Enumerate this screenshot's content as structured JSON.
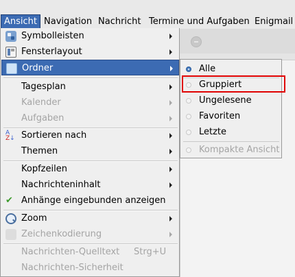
{
  "menubar": {
    "items": [
      {
        "label": "Ansicht",
        "active": true
      },
      {
        "label": "Navigation"
      },
      {
        "label": "Nachricht"
      },
      {
        "label": "Termine und Aufgaben"
      },
      {
        "label": "Enigmail"
      }
    ]
  },
  "menu": {
    "items": [
      {
        "label": "Symbolleisten",
        "icon": "toolbars-icon",
        "submenu": true,
        "enabled": true
      },
      {
        "label": "Fensterlayout",
        "icon": "layout-icon",
        "submenu": true,
        "enabled": true
      },
      {
        "label": "Ordner",
        "icon": "folder-icon",
        "submenu": true,
        "enabled": true,
        "highlighted": true
      },
      {
        "label": "Tagesplan",
        "submenu": true,
        "enabled": true
      },
      {
        "label": "Kalender",
        "submenu": true,
        "enabled": false
      },
      {
        "label": "Aufgaben",
        "submenu": true,
        "enabled": false
      },
      {
        "label": "Sortieren nach",
        "icon": "sort-az-icon",
        "submenu": true,
        "enabled": true
      },
      {
        "label": "Themen",
        "submenu": true,
        "enabled": true
      },
      {
        "label": "Kopfzeilen",
        "submenu": true,
        "enabled": true
      },
      {
        "label": "Nachrichteninhalt",
        "submenu": true,
        "enabled": true
      },
      {
        "label": "Anhänge eingebunden anzeigen",
        "icon": "check-icon",
        "checked": true,
        "enabled": true
      },
      {
        "label": "Zoom",
        "icon": "zoom-icon",
        "submenu": true,
        "enabled": true
      },
      {
        "label": "Zeichenkodierung",
        "icon": "charset-icon",
        "submenu": true,
        "enabled": false
      },
      {
        "label": "Nachrichten-Quelltext",
        "shortcut": "Strg+U",
        "enabled": false
      },
      {
        "label": "Nachrichten-Sicherheit",
        "enabled": false
      }
    ]
  },
  "submenu": {
    "items": [
      {
        "label": "Alle",
        "selected": true,
        "enabled": true
      },
      {
        "label": "Gruppiert",
        "selected": false,
        "enabled": true,
        "outlined": true
      },
      {
        "label": "Ungelesene",
        "selected": false,
        "enabled": true
      },
      {
        "label": "Favoriten",
        "selected": false,
        "enabled": true
      },
      {
        "label": "Letzte",
        "selected": false,
        "enabled": true
      },
      {
        "label": "Kompakte Ansicht",
        "selected": false,
        "enabled": false
      }
    ]
  },
  "colors": {
    "highlight": "#3c6bb3",
    "outline": "#e00000",
    "disabled_text": "#a4a4a4"
  }
}
